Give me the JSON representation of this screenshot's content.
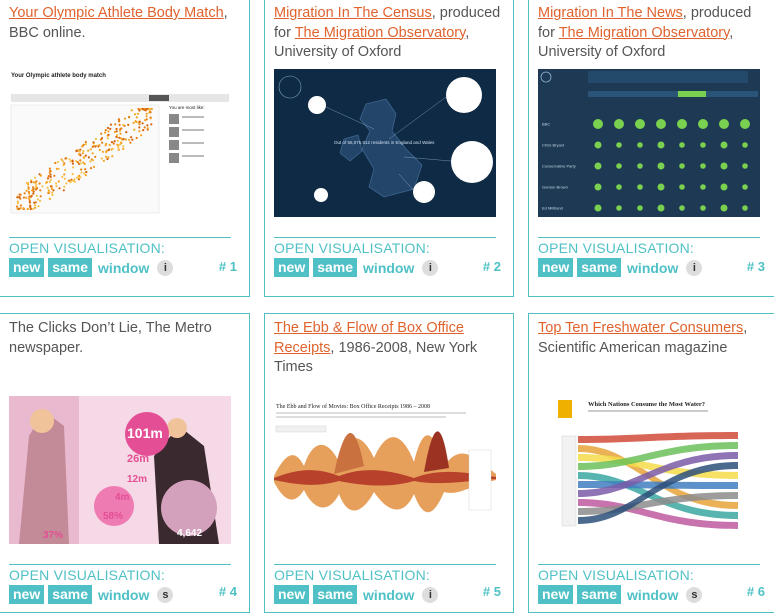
{
  "cards": [
    {
      "link": "Your Olympic Athlete Body Match",
      "rest": ", BBC online.",
      "link2": "",
      "rest2": "",
      "open": "OPEN VISUALISATION:",
      "new": "new",
      "same": "same",
      "window": "window",
      "info": "i",
      "num": "# 1",
      "thumb": {
        "title": "Your Olympic athlete body match",
        "sub": "You are most like:"
      }
    },
    {
      "link": "Migration In The Census",
      "rest": ", produced for ",
      "link2": "The Migration Observatory",
      "rest2": ", University of Oxford",
      "open": "OPEN VISUALISATION:",
      "new": "new",
      "same": "same",
      "window": "window",
      "info": "i",
      "num": "# 2",
      "thumb": {
        "text": "Out of 56,075,912 residents in England and Wales"
      }
    },
    {
      "link": "Migration In The News",
      "rest": ", produced for ",
      "link2": "The Migration Observatory",
      "rest2": ", University of Oxford",
      "open": "OPEN VISUALISATION:",
      "new": "new",
      "same": "same",
      "window": "window",
      "info": "i",
      "num": "# 3",
      "thumb": {
        "rows": [
          "BBC",
          "Chris Bryant",
          "Conservative Party",
          "Gordon Brown",
          "Ed Miliband"
        ]
      }
    },
    {
      "link": "",
      "rest": "The Clicks Don’t Lie, The Metro newspaper.",
      "link2": "",
      "rest2": "",
      "open": "OPEN VISUALISATION:",
      "new": "new",
      "same": "same",
      "window": "window",
      "info": "s",
      "num": "# 4",
      "thumb": {
        "nums": [
          "101m",
          "26m",
          "12m",
          "4m",
          "58%",
          "37%",
          "4,642"
        ]
      }
    },
    {
      "link": "The Ebb & Flow of Box Office Receipts",
      "rest": ", 1986-2008, New York Times",
      "link2": "",
      "rest2": "",
      "open": "OPEN VISUALISATION:",
      "new": "new",
      "same": "same",
      "window": "window",
      "info": "i",
      "num": "# 5",
      "thumb": {
        "title": "The Ebb and Flow of Movies: Box Office Receipts 1986 – 2008"
      }
    },
    {
      "link": "Top Ten Freshwater Consumers",
      "rest": ", Scientific American magazine",
      "link2": "",
      "rest2": "",
      "open": "OPEN VISUALISATION:",
      "new": "new",
      "same": "same",
      "window": "window",
      "info": "s",
      "num": "# 6",
      "thumb": {
        "title": "Which Nations Consume the Most Water?"
      }
    }
  ],
  "colors": {
    "accent": "#4fc1c6",
    "link": "#e0632e",
    "text": "#555555"
  }
}
